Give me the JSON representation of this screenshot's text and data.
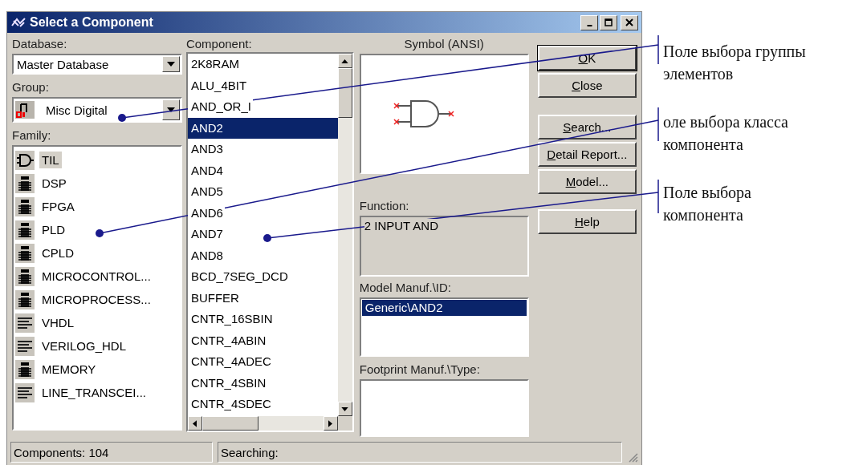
{
  "window": {
    "title": "Select a Component"
  },
  "database": {
    "label": "Database:",
    "value": "Master Database"
  },
  "group": {
    "label": "Group:",
    "value": "Misc Digital"
  },
  "family": {
    "label": "Family:",
    "items": [
      {
        "label": "TIL",
        "kind": "gate",
        "selected": true
      },
      {
        "label": "DSP",
        "kind": "chip",
        "selected": false
      },
      {
        "label": "FPGA",
        "kind": "chip",
        "selected": false
      },
      {
        "label": "PLD",
        "kind": "chip",
        "selected": false
      },
      {
        "label": "CPLD",
        "kind": "chip",
        "selected": false
      },
      {
        "label": "MICROCONTROL...",
        "kind": "chip",
        "selected": false
      },
      {
        "label": "MICROPROCESS...",
        "kind": "chip",
        "selected": false
      },
      {
        "label": "VHDL",
        "kind": "hdl",
        "selected": false
      },
      {
        "label": "VERILOG_HDL",
        "kind": "hdl",
        "selected": false
      },
      {
        "label": "MEMORY",
        "kind": "chip",
        "selected": false
      },
      {
        "label": "LINE_TRANSCEI...",
        "kind": "hdl",
        "selected": false
      }
    ]
  },
  "component": {
    "label": "Component:",
    "items": [
      {
        "label": "2K8RAM",
        "selected": false
      },
      {
        "label": "ALU_4BIT",
        "selected": false
      },
      {
        "label": "AND_OR_I",
        "selected": false
      },
      {
        "label": "AND2",
        "selected": true
      },
      {
        "label": "AND3",
        "selected": false
      },
      {
        "label": "AND4",
        "selected": false
      },
      {
        "label": "AND5",
        "selected": false
      },
      {
        "label": "AND6",
        "selected": false
      },
      {
        "label": "AND7",
        "selected": false
      },
      {
        "label": "AND8",
        "selected": false
      },
      {
        "label": "BCD_7SEG_DCD",
        "selected": false
      },
      {
        "label": "BUFFER",
        "selected": false
      },
      {
        "label": "CNTR_16SBIN",
        "selected": false
      },
      {
        "label": "CNTR_4ABIN",
        "selected": false
      },
      {
        "label": "CNTR_4ADEC",
        "selected": false
      },
      {
        "label": "CNTR_4SBIN",
        "selected": false
      },
      {
        "label": "CNTR_4SDEC",
        "selected": false
      }
    ]
  },
  "symbol": {
    "label": "Symbol (ANSI)"
  },
  "function": {
    "label": "Function:",
    "value": "2 INPUT AND"
  },
  "model": {
    "label": "Model Manuf.\\ID:",
    "items": [
      {
        "label": "Generic\\AND2",
        "selected": true
      }
    ]
  },
  "footprint": {
    "label": "Footprint Manuf.\\Type:"
  },
  "buttons": [
    {
      "mnemonic": "O",
      "rest": "K",
      "default": true
    },
    {
      "mnemonic": "C",
      "rest": "lose",
      "default": false
    },
    {
      "mnemonic": "S",
      "rest": "earch...",
      "default": false
    },
    {
      "mnemonic": "D",
      "rest": "etail Report...",
      "default": false
    },
    {
      "mnemonic": "M",
      "rest": "odel...",
      "default": false
    },
    {
      "mnemonic": "H",
      "rest": "elp",
      "default": false
    }
  ],
  "status_bar": {
    "components": "Components: 104",
    "searching": "Searching:"
  },
  "annotations": [
    {
      "lines": [
        "Поле выбора группы",
        "элементов"
      ]
    },
    {
      "lines": [
        "оле выбора класса",
        "компонента"
      ]
    },
    {
      "lines": [
        "Поле выбора",
        "компонента"
      ]
    }
  ]
}
